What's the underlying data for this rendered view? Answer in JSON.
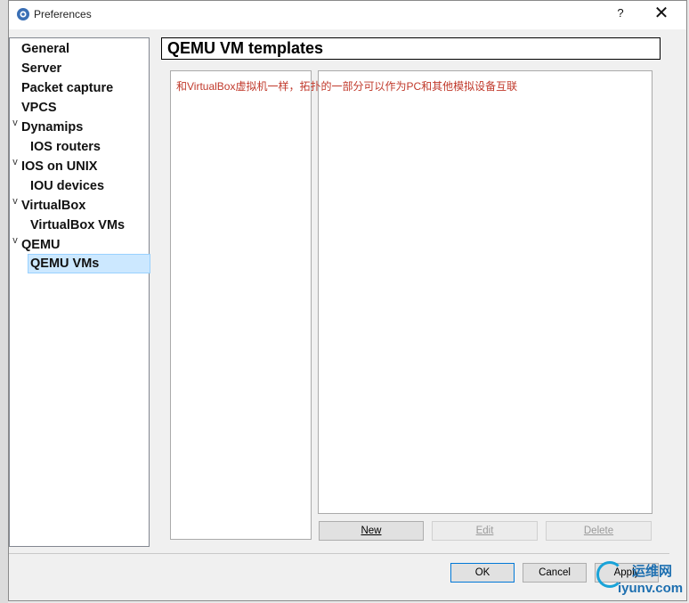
{
  "window": {
    "title": "Preferences",
    "help_label": "?",
    "close_label": "✕"
  },
  "tree": {
    "items": [
      {
        "label": "General",
        "expandable": false
      },
      {
        "label": "Server",
        "expandable": false
      },
      {
        "label": "Packet capture",
        "expandable": false
      },
      {
        "label": "VPCS",
        "expandable": false
      },
      {
        "label": "Dynamips",
        "expandable": true,
        "expanded": true
      },
      {
        "label": "IOS routers",
        "child": true
      },
      {
        "label": "IOS on UNIX",
        "expandable": true,
        "expanded": true
      },
      {
        "label": "IOU devices",
        "child": true
      },
      {
        "label": "VirtualBox",
        "expandable": true,
        "expanded": true
      },
      {
        "label": "VirtualBox VMs",
        "child": true
      },
      {
        "label": "QEMU",
        "expandable": true,
        "expanded": true
      },
      {
        "label": "QEMU VMs",
        "child": true,
        "selected": true
      }
    ],
    "arrow_glyph": "v"
  },
  "page": {
    "title": "QEMU VM templates",
    "note": "和VirtualBox虚拟机一样，拓扑的一部分可以作为PC和其他模拟设备互联"
  },
  "buttons": {
    "new_label": "New",
    "edit_label": "Edit",
    "delete_label": "Delete",
    "ok_label": "OK",
    "cancel_label": "Cancel",
    "apply_label": "Apply"
  },
  "watermark": {
    "top": "运维网",
    "bottom": "iyunv.com"
  },
  "colors": {
    "note_red": "#c0392b",
    "selection_bg": "#cce8ff",
    "focus_blue": "#0078d7"
  }
}
